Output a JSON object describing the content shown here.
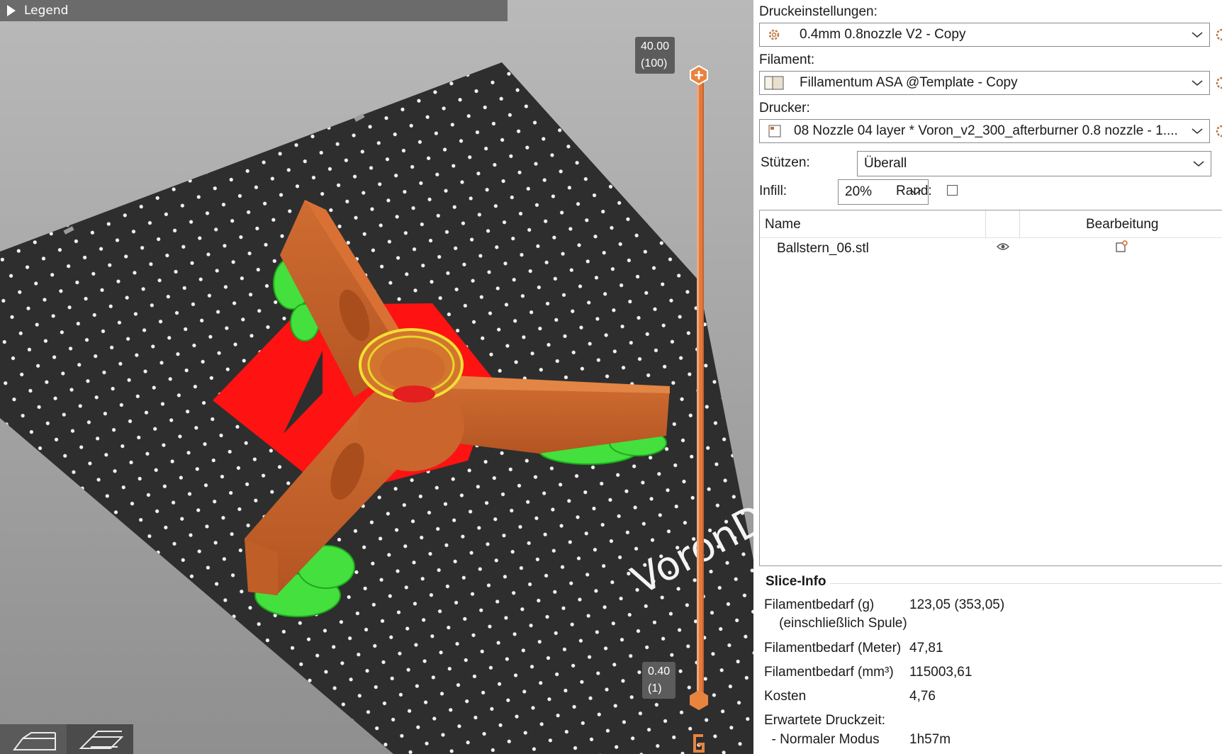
{
  "viewport": {
    "legend_label": "Legend",
    "slider_top": {
      "height": "40.00",
      "layer": "(100)"
    },
    "slider_bottom": {
      "height": "0.40",
      "layer": "(1)"
    },
    "bed_brand_text": "VoronD",
    "colors": {
      "part": "#e07a3c",
      "support": "#3fe23a",
      "overhang": "#ff1111",
      "bed": "#2e2e2e",
      "slider": "#e27a3f"
    },
    "view_buttons": [
      "3d-view-icon",
      "preview-layers-icon"
    ]
  },
  "panel": {
    "print_settings": {
      "label": "Druckeinstellungen:",
      "value": "0.4mm 0.8nozzle V2 - Copy",
      "icon": "gear-icon"
    },
    "filament": {
      "label": "Filament:",
      "value": "Fillamentum ASA @Template - Copy",
      "icon": "filament-spool-icon"
    },
    "printer": {
      "label": "Drucker:",
      "value": "08 Nozzle 04 layer * Voron_v2_300_afterburner 0.8 nozzle - 1....",
      "icon": "printer-icon"
    },
    "supports": {
      "label": "Stützen:",
      "value": "Überall"
    },
    "infill": {
      "label": "Infill:",
      "value": "20%"
    },
    "brim": {
      "label": "Rand:",
      "checked": false
    },
    "object_list": {
      "col_name": "Name",
      "col_edit": "Bearbeitung",
      "rows": [
        {
          "name": "Ballstern_06.stl"
        }
      ]
    },
    "slice_info": {
      "title": "Slice-Info",
      "rows": [
        {
          "label": "Filamentbedarf (g)",
          "value": "123,05 (353,05)"
        },
        {
          "label": "    (einschließlich Spule)",
          "value": ""
        },
        {
          "label": "Filamentbedarf (Meter)",
          "value": "47,81"
        },
        {
          "label": "Filamentbedarf (mm³)",
          "value": "115003,61"
        },
        {
          "label": "Kosten",
          "value": "4,76"
        },
        {
          "label": "Erwartete Druckzeit:",
          "value": ""
        },
        {
          "label": "  - Normaler Modus",
          "value": "1h57m"
        }
      ]
    }
  }
}
